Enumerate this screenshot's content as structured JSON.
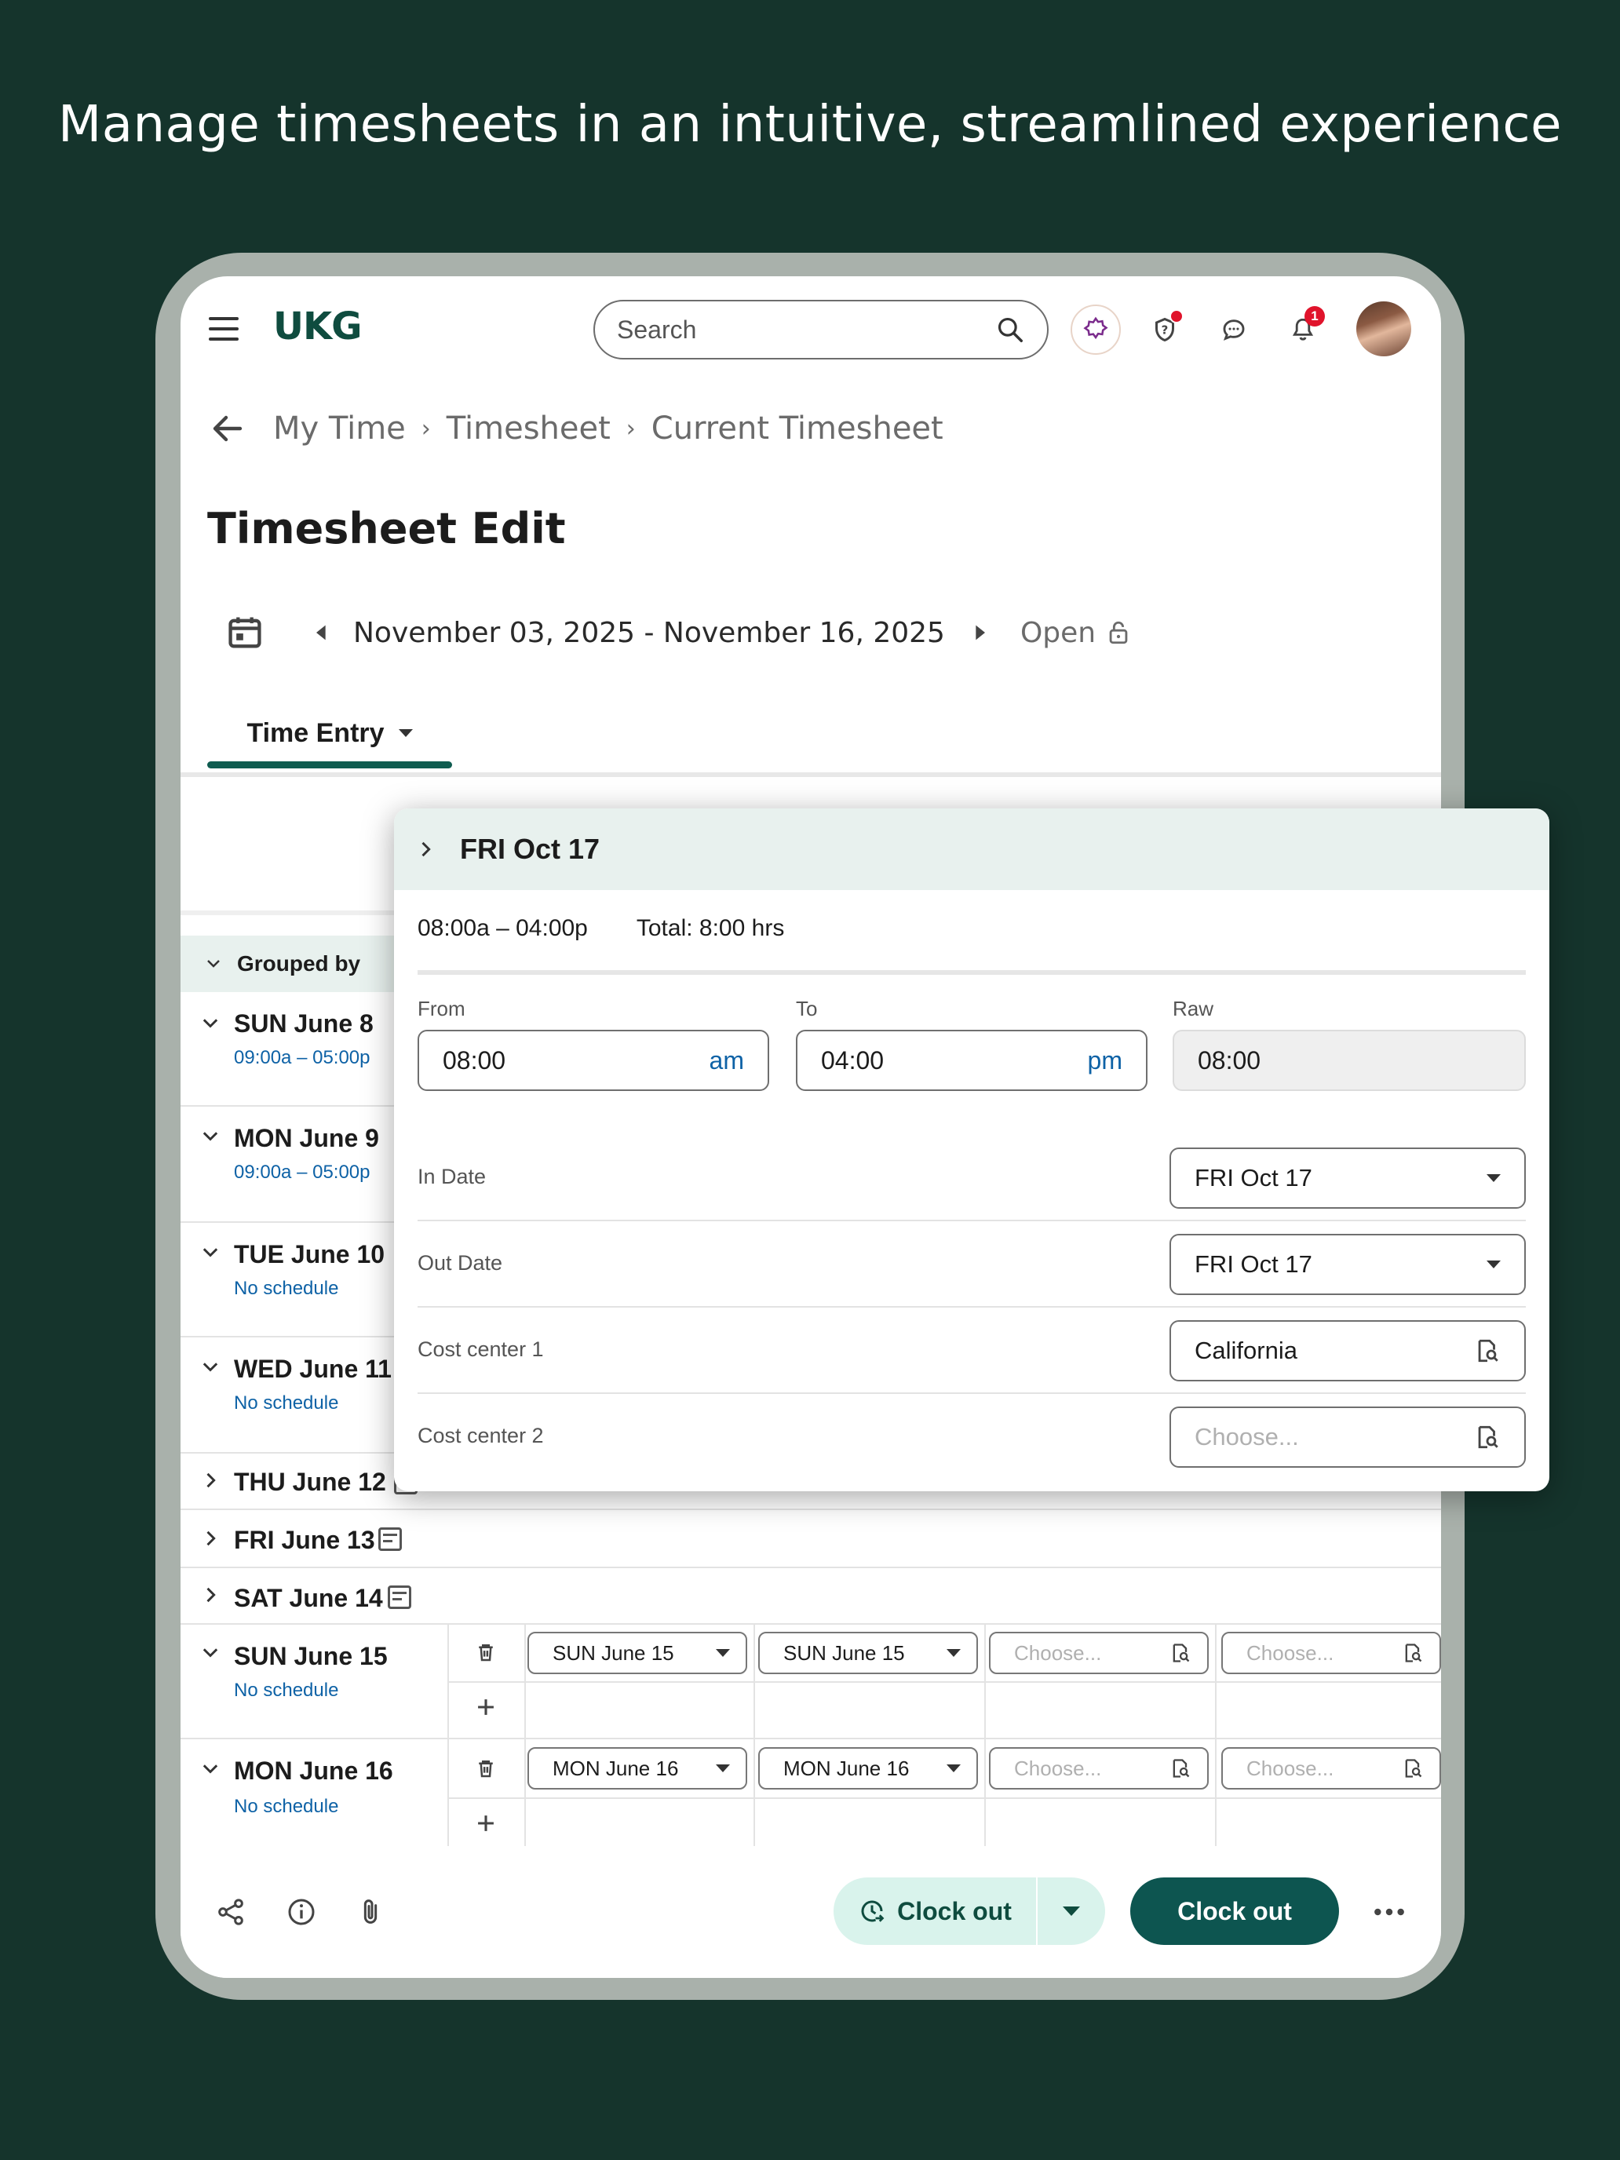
{
  "headline": "Manage timesheets in an intuitive, streamlined experience",
  "app": {
    "logo": "UKG"
  },
  "search": {
    "placeholder": "Search"
  },
  "notifications": {
    "count": "1"
  },
  "breadcrumb": {
    "items": [
      "My Time",
      "Timesheet",
      "Current Timesheet"
    ]
  },
  "page": {
    "title": "Timesheet Edit"
  },
  "period": {
    "range": "November 03, 2025 - November 16, 2025",
    "status": "Open"
  },
  "tabs": {
    "active": "Time Entry"
  },
  "list": {
    "grouped_label": "Grouped by",
    "days": [
      {
        "name": "SUN June 8",
        "sub": "09:00a – 05:00p"
      },
      {
        "name": "MON June 9",
        "sub": "09:00a – 05:00p"
      },
      {
        "name": "TUE June 10",
        "sub": "No schedule"
      },
      {
        "name": "WED June 11",
        "sub": "No schedule"
      },
      {
        "name": "THU June 12"
      },
      {
        "name": "FRI June 13"
      },
      {
        "name": "SAT June 14"
      },
      {
        "name": "SUN June 15",
        "sub": "No schedule",
        "in_date": "SUN June 15",
        "out_date": "SUN June 15",
        "choose1": "Choose...",
        "choose2": "Choose..."
      },
      {
        "name": "MON June 16",
        "sub": "No schedule",
        "in_date": "MON June 16",
        "out_date": "MON June 16",
        "choose1": "Choose...",
        "choose2": "Choose..."
      }
    ]
  },
  "popup": {
    "title": "FRI Oct 17",
    "time_range": "08:00a – 04:00p",
    "total": "Total: 8:00 hrs",
    "from": {
      "label": "From",
      "value": "08:00",
      "unit": "am"
    },
    "to": {
      "label": "To",
      "value": "04:00",
      "unit": "pm"
    },
    "raw": {
      "label": "Raw",
      "value": "08:00"
    },
    "in_date": {
      "label": "In Date",
      "value": "FRI Oct 17"
    },
    "out_date": {
      "label": "Out Date",
      "value": "FRI Oct 17"
    },
    "cost_center_1": {
      "label": "Cost center 1",
      "value": "California"
    },
    "cost_center_2": {
      "label": "Cost center 2",
      "placeholder": "Choose..."
    }
  },
  "actions": {
    "clock_out_secondary": "Clock out",
    "clock_out_primary": "Clock out"
  },
  "colors": {
    "background": "#15342c",
    "accent": "#0d5550",
    "light_accent": "#d9f3ec",
    "link": "#0e62a6"
  }
}
